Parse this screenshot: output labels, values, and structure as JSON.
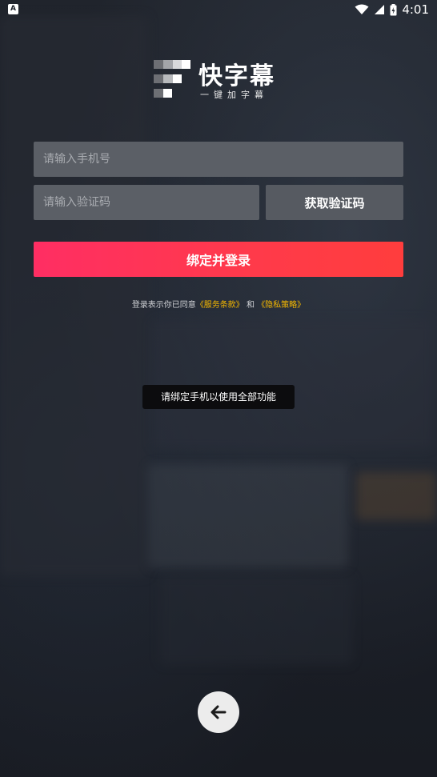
{
  "status_bar": {
    "time": "4:01",
    "notification_icon": "a-notification-icon",
    "wifi_icon": "wifi-icon",
    "signal_icon": "signal-icon",
    "battery_icon": "battery-icon"
  },
  "logo": {
    "title": "快字幕",
    "subtitle": "一键加字幕",
    "icon": "logo-mark-icon"
  },
  "form": {
    "phone_placeholder": "请输入手机号",
    "phone_value": "",
    "code_placeholder": "请输入验证码",
    "code_value": "",
    "get_code_label": "获取验证码",
    "login_label": "绑定并登录"
  },
  "agreement": {
    "prefix": "登录表示你已同意",
    "terms_link": "《服务条款》",
    "connector": "和",
    "privacy_link": "《隐私策略》"
  },
  "toast": {
    "message": "请绑定手机以使用全部功能"
  },
  "navigation": {
    "back_icon": "arrow-left-icon"
  },
  "colors": {
    "accent_start": "#ff2e63",
    "accent_end": "#ff3d3d",
    "link": "#f5b800",
    "background": "#1b1f27"
  }
}
